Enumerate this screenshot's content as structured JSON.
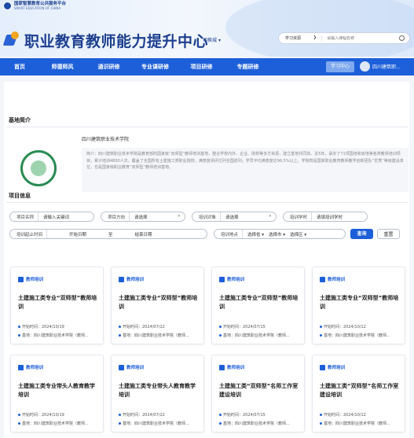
{
  "header": {
    "platform_name": "国家智慧教育公共服务平台",
    "platform_name_en": "SMART EDUCATION OF CHINA",
    "site_title": "职业教育教师能力提升中心",
    "city_selector": "切换城",
    "search_type": "学习资源",
    "search_placeholder": "请输入课程名称"
  },
  "nav": {
    "items": [
      "首页",
      "师德师风",
      "通识研修",
      "专业课研修",
      "项目研修",
      "专题研修"
    ],
    "learning_center": "学习中心",
    "user_name": "四川建筑职..."
  },
  "basic_info": {
    "heading": "基地简介",
    "school_name": "四川建筑职业技术学院",
    "intro": "简介：四川建筑职业技术学院是教育部的国家级“双师型”教师培训基地，整合学校内外、企业、院校等多方资源，建立基地共同体。近5年，承办了71项国培和省培等各类教师培训项目，累计培训4800人次，覆盖了全国所有土建施工类职业院校，满意度测评位列全国前列，学员平均满意度达96.5%以上。学院既是国家职业教育教师教学创新团队“优秀”等级建设单位，也是国家级职业教育“双师型”教师培训基地。"
  },
  "filters": {
    "heading": "项目信息",
    "project_name_label": "项目名称",
    "project_name_placeholder": "请输入关键词",
    "direction_label": "项目方向",
    "direction_value": "请选择",
    "target_label": "培训对象",
    "target_value": "请选择",
    "hours_label": "培训学时",
    "hours_value": "请填培训学时",
    "time_label": "培训起止时间",
    "start_date": "开始日期",
    "date_sep": "至",
    "end_date": "结束日期",
    "location_label": "培训地点",
    "province": "选择省",
    "city": "选择市",
    "district": "选择区",
    "query_button": "查询",
    "reset_button": "重置"
  },
  "cards": [
    {
      "tag": "教师培训",
      "title": "土建施工类专业“双师型”教师培训",
      "start": "开始时间：2024/10/19",
      "base": "基地：四川建筑职业技术学院（教师..."
    },
    {
      "tag": "教师培训",
      "title": "土建施工类专业“双师型”教师培训",
      "start": "开始时间：2024/07/22",
      "base": "基地：四川建筑职业技术学院（教师..."
    },
    {
      "tag": "教师培训",
      "title": "土建施工类专业“双师型”教师培训",
      "start": "开始时间：2024/07/15",
      "base": "基地：四川建筑职业技术学院（教师..."
    },
    {
      "tag": "教师培训",
      "title": "土建施工类专业“双师型”教师培训",
      "start": "开始时间：2024/10/12",
      "base": "基地：四川建筑职业技术学院（教师..."
    },
    {
      "tag": "教师培训",
      "title": "土建施工类专业带头人教育教学培训",
      "start": "开始时间：2024/10/19",
      "base": "基地：四川建筑职业技术学院（教师..."
    },
    {
      "tag": "教师培训",
      "title": "土建施工类专业带头人教育教学培训",
      "start": "开始时间：2024/07/22",
      "base": "基地：四川建筑职业技术学院（教师..."
    },
    {
      "tag": "教师培训",
      "title": "土建施工类“双师型”名师工作室建设培训",
      "start": "开始时间：2024/07/15",
      "base": "基地：四川建筑职业技术学院（教师..."
    },
    {
      "tag": "教师培训",
      "title": "土建施工类“双师型”名师工作室建设培训",
      "start": "开始时间：2024/10/12",
      "base": "基地：四川建筑职业技术学院（教师..."
    }
  ]
}
